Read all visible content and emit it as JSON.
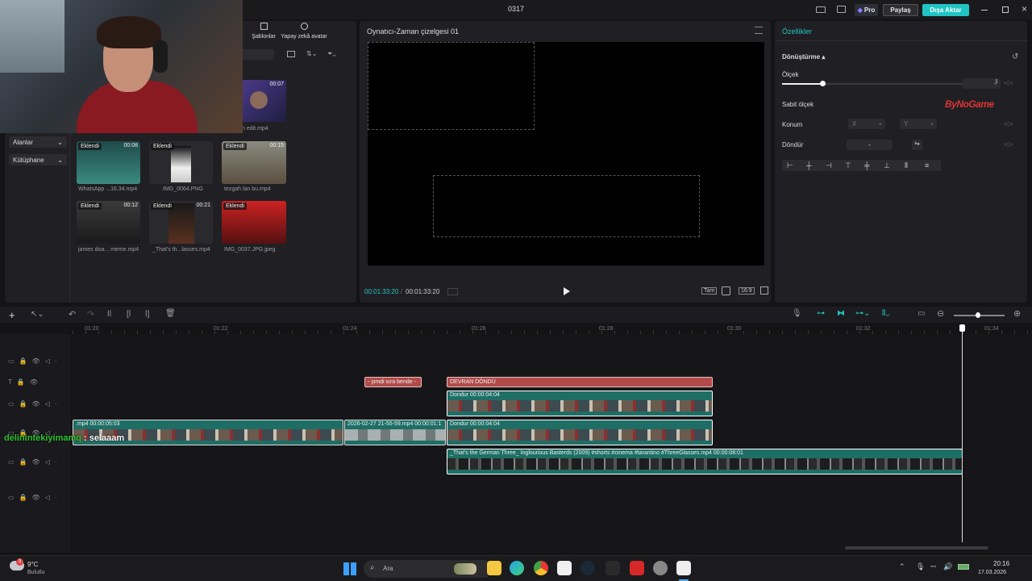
{
  "window": {
    "title": "0317"
  },
  "header": {
    "pro": "Pro",
    "share": "Paylaş",
    "export": "Dışa Aktar"
  },
  "media_panel": {
    "tabs": [
      {
        "label": "Şablonlar"
      },
      {
        "label": "Yapay zekâ avatar"
      }
    ],
    "sidebar": [
      {
        "label": "Alanlar"
      },
      {
        "label": "Kütüphane"
      }
    ],
    "items": [
      {
        "name": "n edit.mp4",
        "badge": "",
        "duration": "00:07"
      },
      {
        "name": "WhatsApp ...16.34.mp4",
        "badge": "Eklendi",
        "duration": "00:08"
      },
      {
        "name": "IMG_0064.PNG",
        "badge": "Eklendi",
        "duration": ""
      },
      {
        "name": "tezgah lan bu.mp4",
        "badge": "Eklendi",
        "duration": "00:15"
      },
      {
        "name": "james doa... meme.mp4",
        "badge": "Eklendi",
        "duration": "00:12"
      },
      {
        "name": "_That's th...lasses.mp4",
        "badge": "Eklendi",
        "duration": "00:21"
      },
      {
        "name": "IMG_0037.JPG.jpeg",
        "badge": "Eklendi",
        "duration": ""
      }
    ]
  },
  "player": {
    "title": "Oynatıcı-Zaman çizelgesi 01",
    "current_time": "00:01:33:20",
    "total_time": "00:01:33:20",
    "full_label": "Tam",
    "ratio_label": "16:9"
  },
  "properties": {
    "tab": "Özellikler",
    "section": "Dönüştürme",
    "scale_label": "Ölçek",
    "scale_value": "-",
    "scale_level": 0.22,
    "lock_scale_label": "Sabit ölçek",
    "position_label": "Konum",
    "x_label": "X",
    "x_value": "-",
    "y_label": "Y",
    "y_value": "-",
    "rotate_label": "Döndür",
    "rotate_value": "-",
    "watermark": "ByNoGame"
  },
  "timeline": {
    "ruler": [
      "01:20",
      "01:22",
      "01:24",
      "01:26",
      "01:28",
      "01:30",
      "01:32",
      "01:34"
    ],
    "clips": {
      "text1": "- şimdi sıra bende -",
      "text2": "DEVRAN DÖNDÜ",
      "v2_label": "Dondur  00:00:04:04",
      "v1a_label": ".mp4  00:00:05:03",
      "v1b_label": "2026-02-27 21-55-59.mp4  00:00:01:1",
      "v1c_label": "Dondur  00:00:04:04",
      "v0_label": "_That's the German Three_ Inglourious Basterds (2009) #shorts #cinema #tarantino #ThreeGlasses.mp4  00:00:08:01"
    },
    "chat": {
      "user": "delinintekiyimamq",
      "message": " : selaaam"
    }
  },
  "taskbar": {
    "weather_temp": "9°C",
    "weather_desc": "Bulutlu",
    "weather_badge": "3",
    "search": "Ara",
    "time": "20:16",
    "date": "17.03.2026"
  }
}
